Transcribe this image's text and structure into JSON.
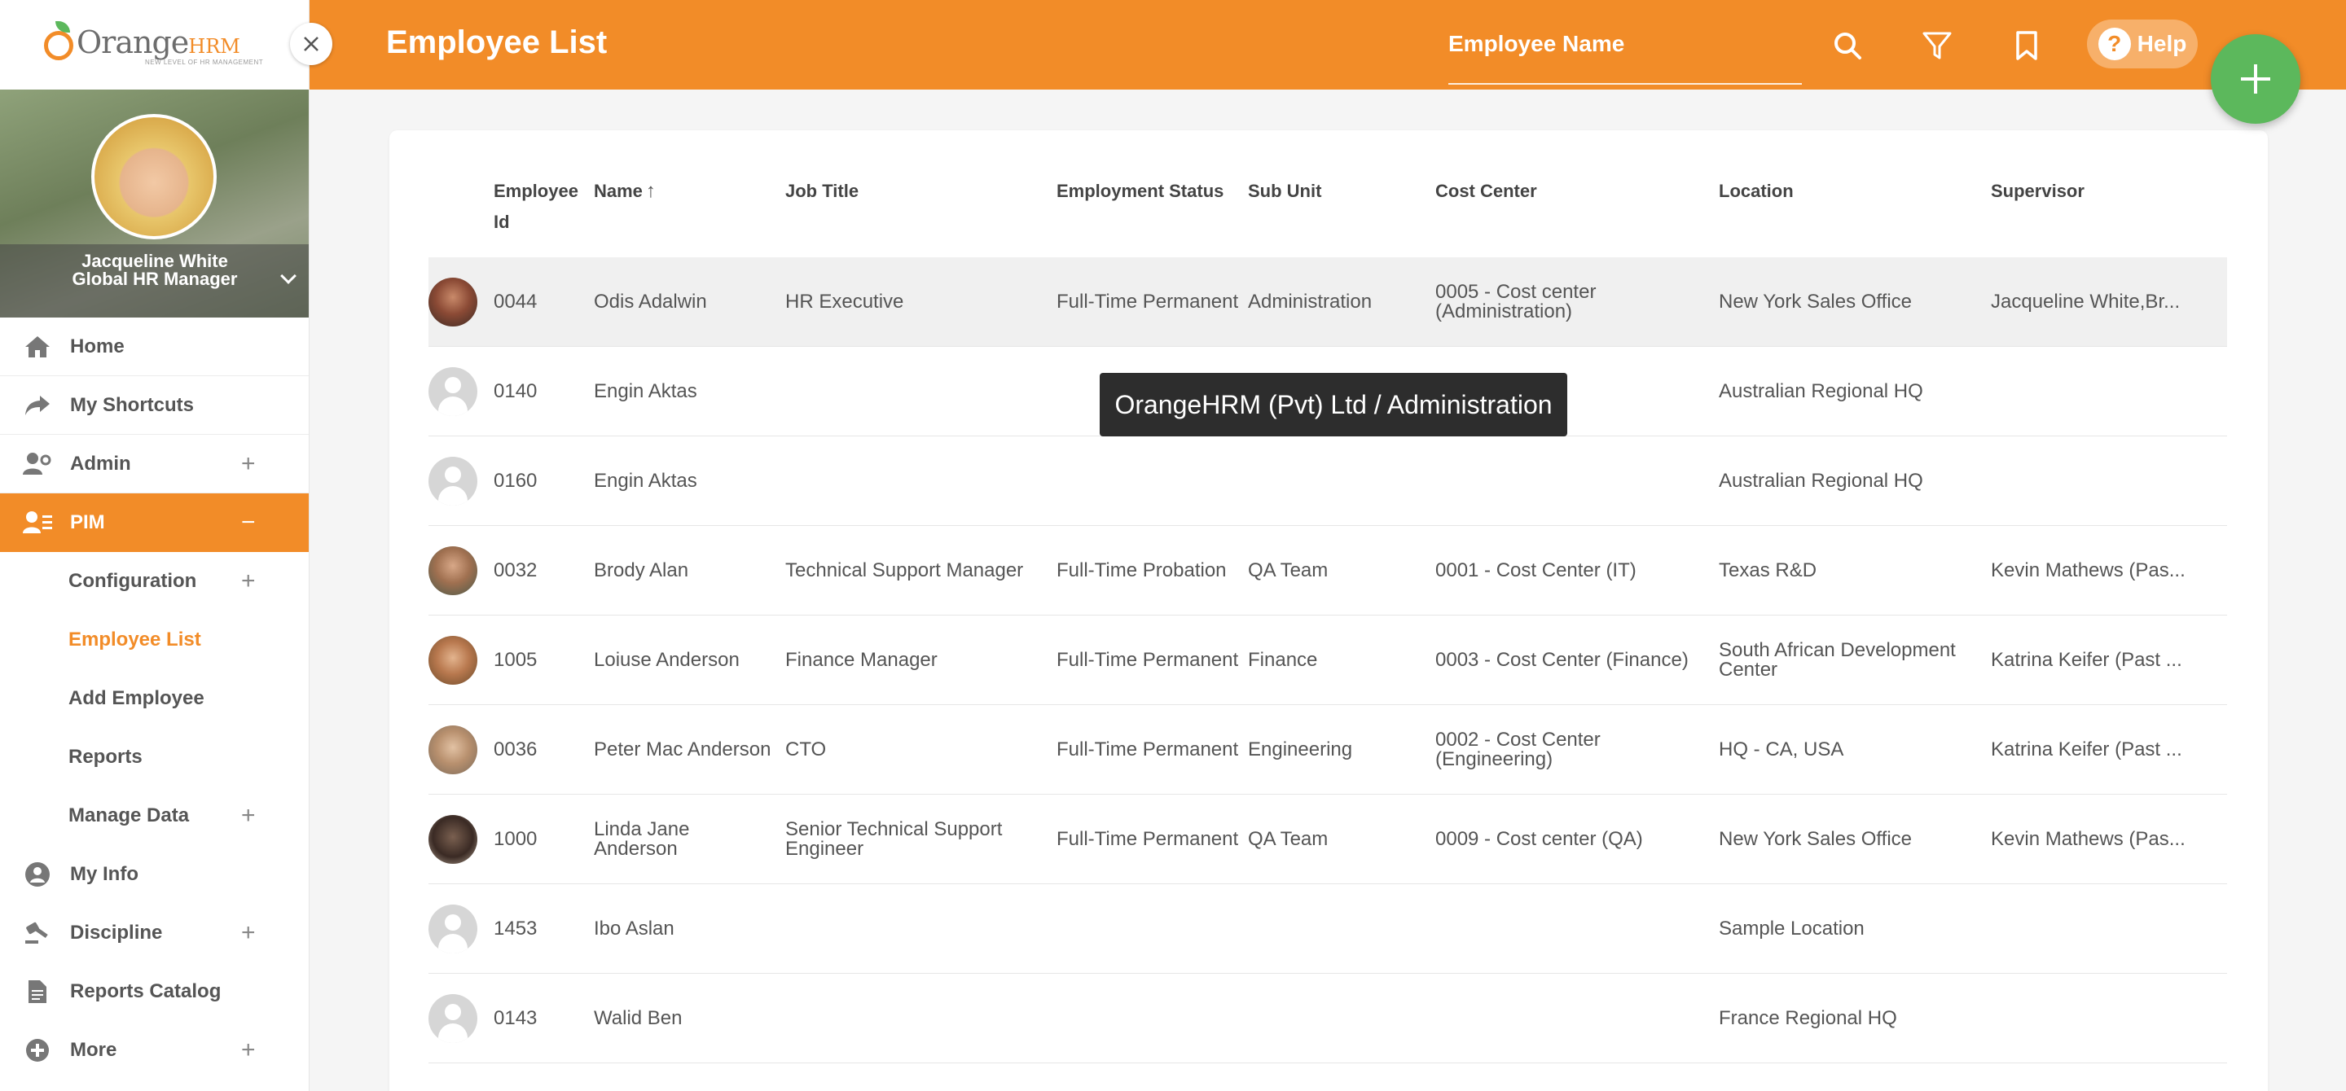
{
  "sidebar": {
    "logo_text": "Orange",
    "logo_hrm": "HRM",
    "logo_tagline": "NEW LEVEL OF HR MANAGEMENT",
    "user_name": "Jacqueline White",
    "user_role": "Global HR Manager",
    "items": [
      {
        "label": "Home",
        "icon": "home-icon"
      },
      {
        "label": "My Shortcuts",
        "icon": "share-icon"
      },
      {
        "label": "Admin",
        "icon": "admin-icon"
      },
      {
        "label": "PIM",
        "icon": "pim-icon"
      },
      {
        "label": "Configuration"
      },
      {
        "label": "Employee List"
      },
      {
        "label": "Add Employee"
      },
      {
        "label": "Reports"
      },
      {
        "label": "Manage Data"
      },
      {
        "label": "My Info",
        "icon": "user-circle-icon"
      },
      {
        "label": "Discipline",
        "icon": "discipline-icon"
      },
      {
        "label": "Reports Catalog",
        "icon": "document-icon"
      },
      {
        "label": "More",
        "icon": "plus-circle-icon"
      }
    ]
  },
  "header": {
    "title": "Employee List",
    "search_placeholder": "Employee Name",
    "help_label": "Help",
    "accent_color": "#f28c28",
    "fab_color": "#5cb85c"
  },
  "table": {
    "columns": [
      "Employee Id",
      "Name",
      "Job Title",
      "Employment Status",
      "Sub Unit",
      "Cost Center",
      "Location",
      "Supervisor"
    ],
    "sort_column": "Name",
    "rows": [
      {
        "id": "0044",
        "name": "Odis Adalwin",
        "job": "HR Executive",
        "status": "Full-Time Permanent",
        "subunit": "Administration",
        "cost": "0005 - Cost center (Administration)",
        "location": "New York Sales Office",
        "supervisor": "Jacqueline White,Br...",
        "photo": true
      },
      {
        "id": "0140",
        "name": "Engin Aktas",
        "job": "",
        "status": "",
        "subunit": "",
        "cost": "",
        "location": "Australian Regional HQ",
        "supervisor": "",
        "photo": false
      },
      {
        "id": "0160",
        "name": "Engin Aktas",
        "job": "",
        "status": "",
        "subunit": "",
        "cost": "",
        "location": "Australian Regional HQ",
        "supervisor": "",
        "photo": false
      },
      {
        "id": "0032",
        "name": "Brody Alan",
        "job": "Technical Support Manager",
        "status": "Full-Time Probation",
        "subunit": "QA Team",
        "cost": "0001 - Cost Center (IT)",
        "location": "Texas R&D",
        "supervisor": "Kevin Mathews (Pas...",
        "photo": true
      },
      {
        "id": "1005",
        "name": "Loiuse Anderson",
        "job": "Finance Manager",
        "status": "Full-Time Permanent",
        "subunit": "Finance",
        "cost": "0003 - Cost Center (Finance)",
        "location": "South African Development Center",
        "supervisor": "Katrina Keifer (Past ...",
        "photo": true
      },
      {
        "id": "0036",
        "name": "Peter Mac Anderson",
        "job": "CTO",
        "status": "Full-Time Permanent",
        "subunit": "Engineering",
        "cost": "0002 - Cost Center (Engineering)",
        "location": "HQ - CA, USA",
        "supervisor": "Katrina Keifer (Past ...",
        "photo": true
      },
      {
        "id": "1000",
        "name": "Linda Jane Anderson",
        "job": "Senior Technical Support Engineer",
        "status": "Full-Time Permanent",
        "subunit": "QA Team",
        "cost": "0009 - Cost center (QA)",
        "location": "New York Sales Office",
        "supervisor": "Kevin Mathews (Pas...",
        "photo": true
      },
      {
        "id": "1453",
        "name": "Ibo Aslan",
        "job": "",
        "status": "",
        "subunit": "",
        "cost": "",
        "location": "Sample Location",
        "supervisor": "",
        "photo": false
      },
      {
        "id": "0143",
        "name": "Walid Ben",
        "job": "",
        "status": "",
        "subunit": "",
        "cost": "",
        "location": "France Regional HQ",
        "supervisor": "",
        "photo": false
      }
    ]
  },
  "tooltip": "OrangeHRM (Pvt) Ltd / Administration"
}
